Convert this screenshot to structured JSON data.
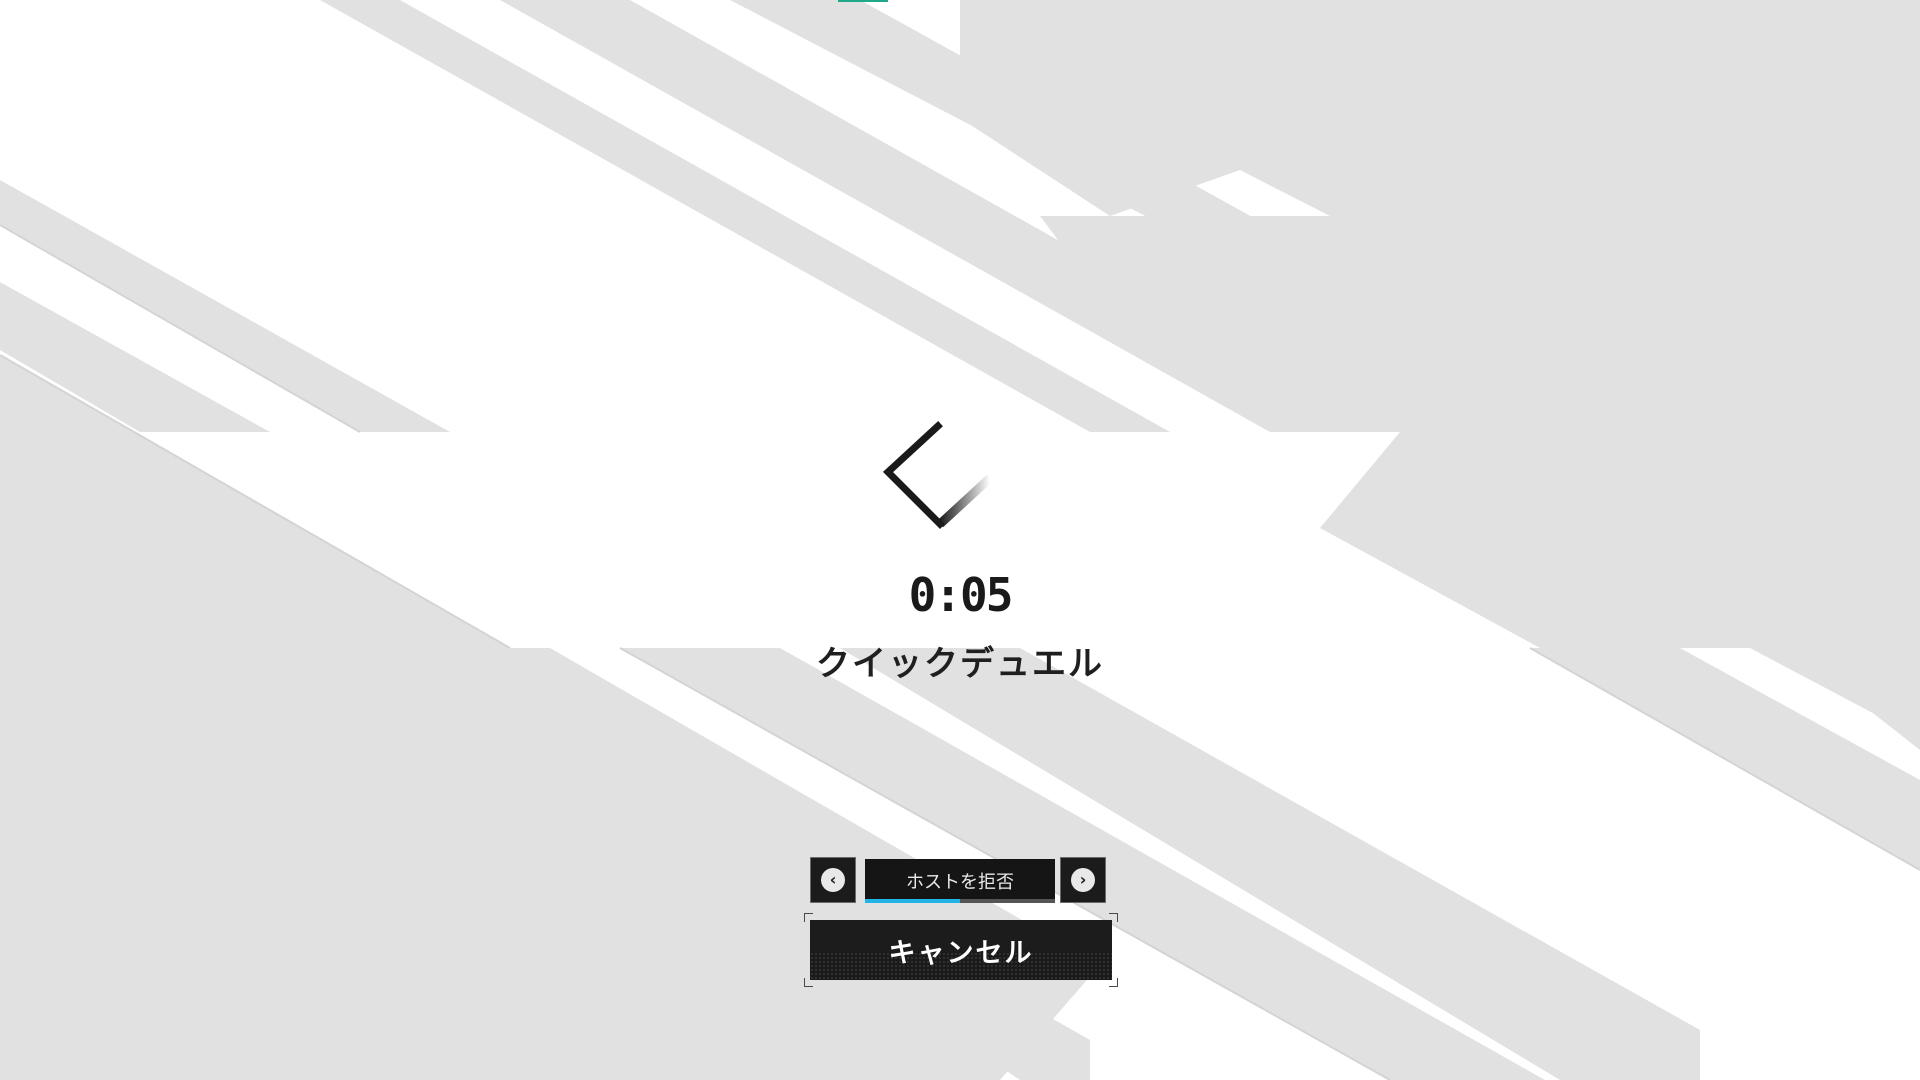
{
  "screen": {
    "timer": "0:05",
    "mode_title": "クイックデュエル"
  },
  "actions": {
    "prev_icon": "chevron-left-circle-icon",
    "next_icon": "chevron-right-circle-icon",
    "reject_host_label": "ホストを拒否",
    "reject_host_progress": 0.5,
    "cancel_label": "キャンセル"
  },
  "colors": {
    "stripe_gray": "#e1e1e1",
    "accent_cyan": "#22b4e6",
    "accent_green": "#1fa98a",
    "button_dark": "#151515"
  }
}
